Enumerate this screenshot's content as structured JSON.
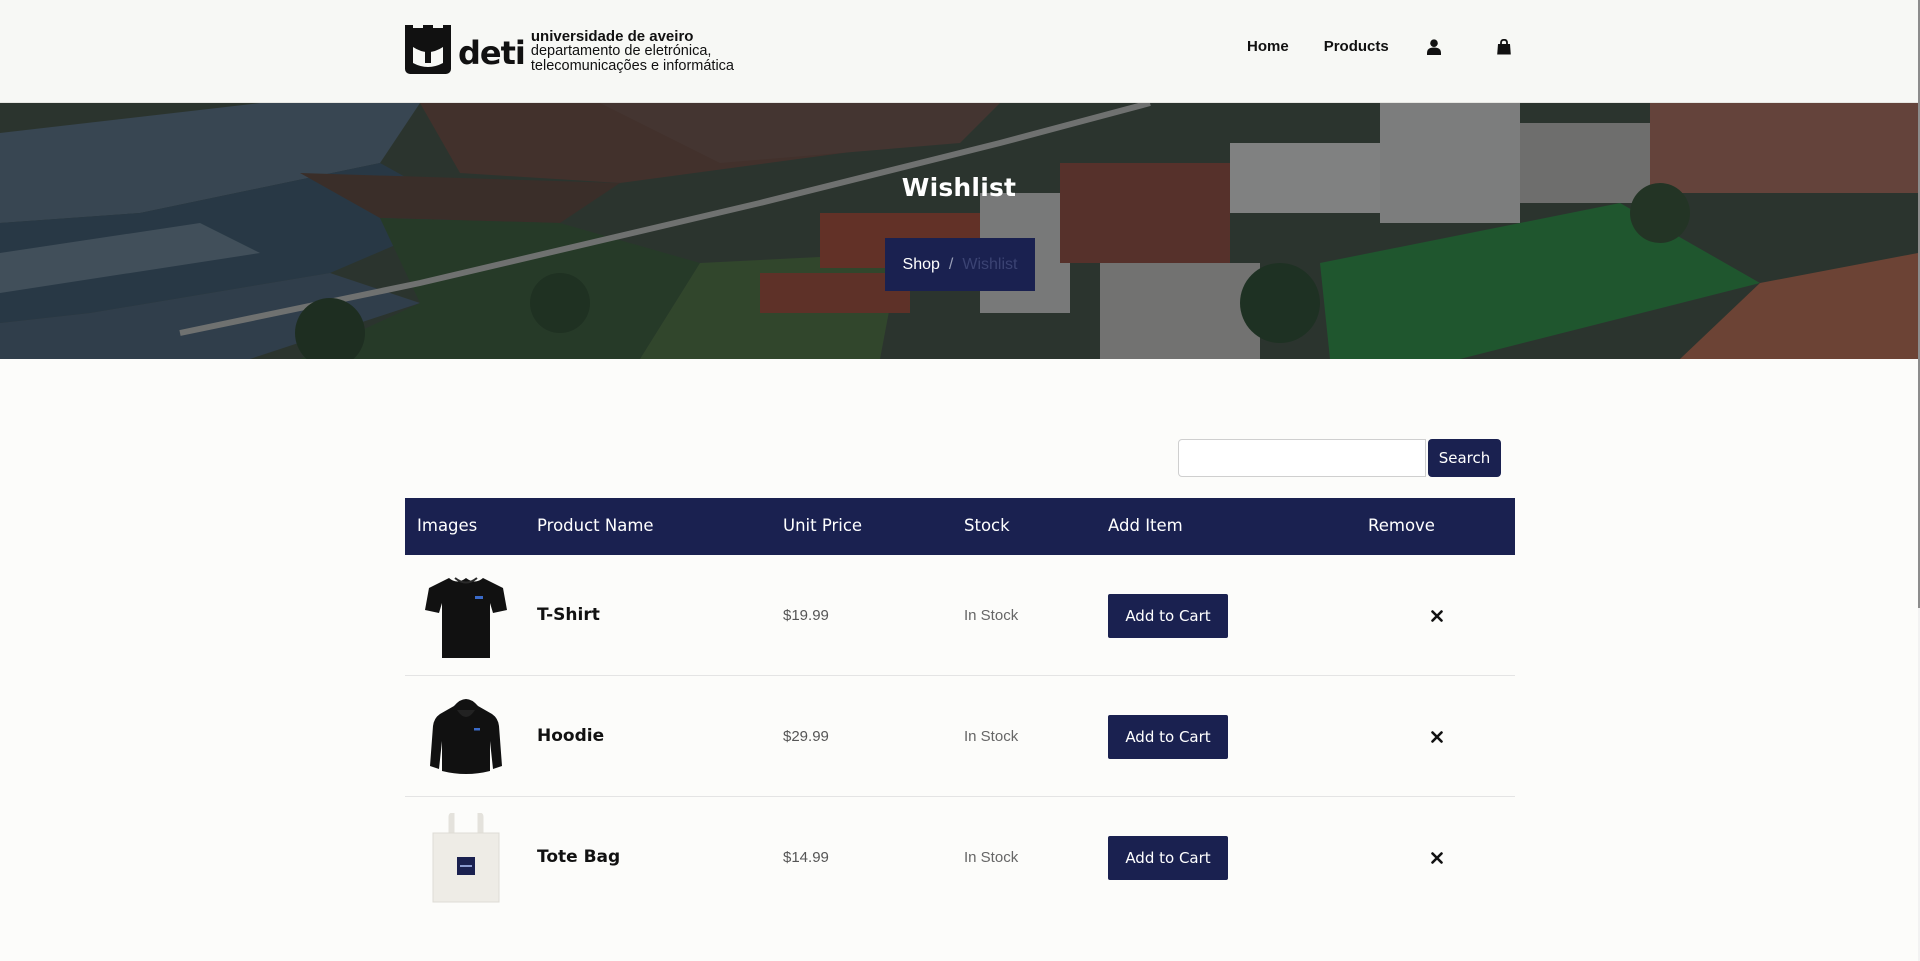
{
  "header": {
    "logo": {
      "mark": "deti",
      "line1": "universidade de aveiro",
      "line2": "departamento de eletrónica,",
      "line3": "telecomunicações e informática"
    },
    "nav": {
      "home": "Home",
      "products": "Products",
      "user_icon": "user-icon",
      "cart_icon": "shopping-bag-icon"
    }
  },
  "hero": {
    "title": "Wishlist",
    "breadcrumb": {
      "shop": "Shop",
      "separator": "/",
      "current": "Wishlist"
    }
  },
  "search": {
    "value": "",
    "placeholder": "",
    "button": "Search"
  },
  "table": {
    "headers": {
      "images": "Images",
      "product_name": "Product Name",
      "unit_price": "Unit Price",
      "stock": "Stock",
      "add_item": "Add Item",
      "remove": "Remove"
    },
    "rows": [
      {
        "image": "t-shirt-image",
        "name": "T-Shirt",
        "price": "$19.99",
        "stock": "In Stock",
        "action": "Add to Cart",
        "remove_icon": "close-icon"
      },
      {
        "image": "hoodie-image",
        "name": "Hoodie",
        "price": "$29.99",
        "stock": "In Stock",
        "action": "Add to Cart",
        "remove_icon": "close-icon"
      },
      {
        "image": "tote-bag-image",
        "name": "Tote Bag",
        "price": "$14.99",
        "stock": "In Stock",
        "action": "Add to Cart",
        "remove_icon": "close-icon"
      }
    ]
  },
  "colors": {
    "navy": "#1a2150",
    "header_bg": "#f7f8f5",
    "page_bg": "#fcfcfa"
  }
}
